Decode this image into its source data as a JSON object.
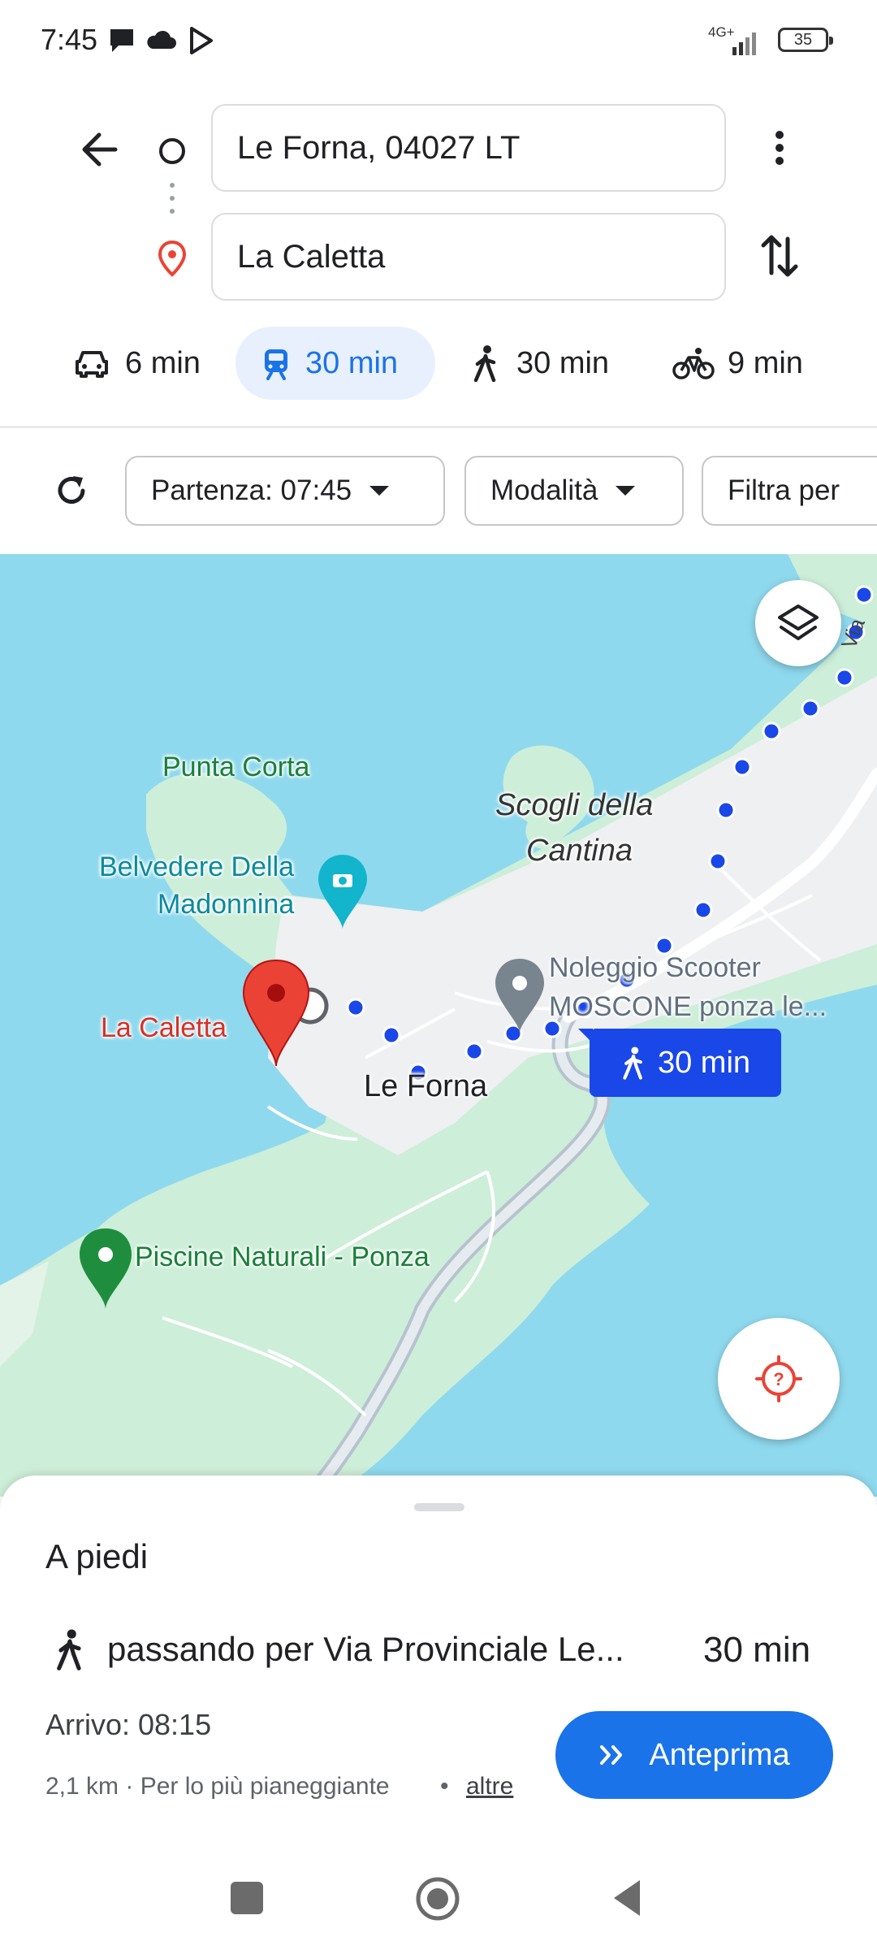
{
  "status_bar": {
    "time": "7:45",
    "network": "4G+",
    "battery": "35"
  },
  "header": {
    "origin_value": "Le Forna, 04027 LT",
    "destination_value": "La Caletta"
  },
  "modes": [
    {
      "name": "car",
      "label": "6 min"
    },
    {
      "name": "transit",
      "label": "30 min"
    },
    {
      "name": "walk",
      "label": "30 min"
    },
    {
      "name": "bike",
      "label": "9 min"
    }
  ],
  "filters": {
    "departure": "Partenza: 07:45",
    "mode": "Modalità",
    "filter": "Filtra per"
  },
  "map": {
    "labels": {
      "punta_corta": "Punta Corta",
      "belvedere_1": "Belvedere Della",
      "belvedere_2": "Madonnina",
      "scogli_1": "Scogli della",
      "scogli_2": "Cantina",
      "noleggio_1": "Noleggio Scooter",
      "noleggio_2": "MOSCONE ponza le...",
      "la_caletta": "La Caletta",
      "le_forna": "Le Forna",
      "piscine": "Piscine Naturali - Ponza",
      "via": "Via"
    },
    "route_badge": "30 min"
  },
  "sheet": {
    "title": "A piedi",
    "route_desc": "passando per Via Provinciale Le...",
    "duration": "30 min",
    "arrival": "Arrivo: 08:15",
    "details": "2,1 km · Per lo più pianeggiante",
    "dot": "•",
    "more": "altre",
    "preview_button": "Anteprima"
  },
  "colors": {
    "accent": "#1a73e8",
    "route": "#1a47e8",
    "pin": "#ea4335",
    "water": "#8fd9ee",
    "land": "#cdeed8"
  }
}
